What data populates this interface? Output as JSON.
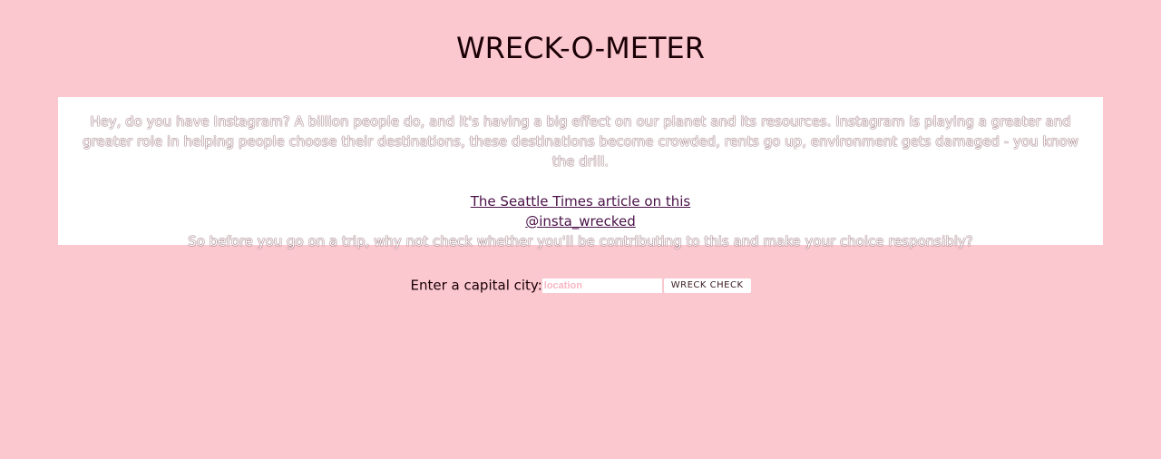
{
  "header": {
    "title": "WRECK-O-METER"
  },
  "info": {
    "intro": "Hey, do you have Instagram? A billion people do, and it's having a big effect on our planet and its resources. Instagram is playing a greater and greater role in helping people choose their destinations, these destinations become crowded, rents go up, environment gets damaged - you know the drill.",
    "article_link": "The Seattle Times article on this",
    "insta_link": "@insta_wrecked",
    "outro": "So before you go on a trip, why not check whether you'll be contributing to this and make your choice responsibly?"
  },
  "form": {
    "label": "Enter a capital city:",
    "placeholder": "location",
    "value": "",
    "button": "WRECK CHECK"
  }
}
